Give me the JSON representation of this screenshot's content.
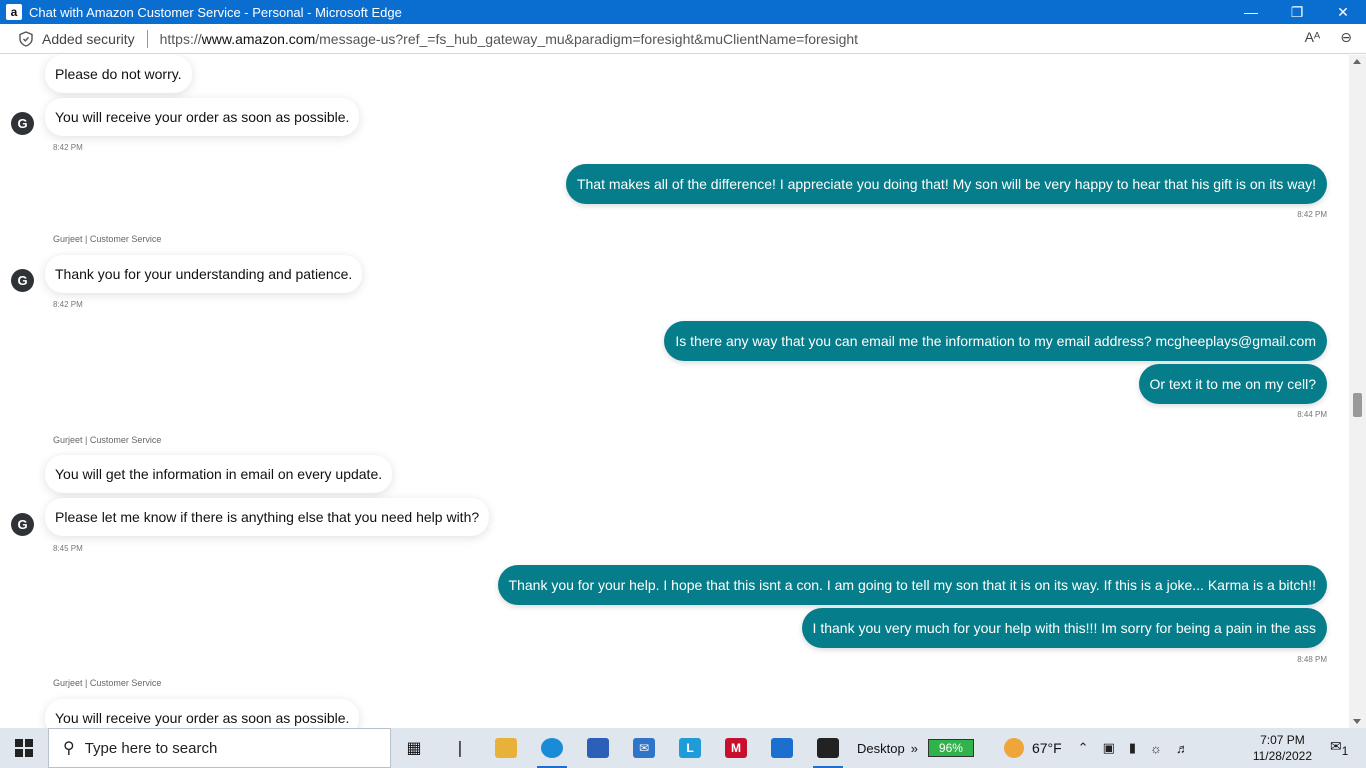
{
  "window": {
    "title": "Chat with Amazon Customer Service - Personal - Microsoft Edge",
    "app_icon": "a",
    "minimize": "—",
    "restore": "❐",
    "close": "✕"
  },
  "addressbar": {
    "security_label": "Added security",
    "url_prefix": "https://",
    "url_host": "www.amazon.com",
    "url_path": "/message-us?ref_=fs_hub_gateway_mu&paradigm=foresight&muClientName=foresight",
    "read_aloud_icon": "Aᴬ",
    "zoom_icon": "⊖"
  },
  "chat": {
    "agent_initial": "G",
    "messages": [
      {
        "text": "Please do not worry."
      },
      {
        "text": "You will receive your order as soon as possible.",
        "time": "8:42 PM"
      },
      {
        "text": "That makes all of the difference! I appreciate you doing that! My son will be very happy to hear that his gift is on its way!",
        "time": "8:42 PM"
      },
      {
        "sender": "Gurjeet | Customer Service",
        "text": "Thank you for your understanding and patience.",
        "time": "8:42 PM"
      },
      {
        "text": "Is there any way that you can email me the information to my email address? mcgheeplays@gmail.com"
      },
      {
        "text": "Or text it to me on my cell?",
        "time": "8:44 PM"
      },
      {
        "sender": "Gurjeet | Customer Service",
        "text": "You will get the information in email on every update."
      },
      {
        "text": "Please let me know if there is anything else that you need help with?",
        "time": "8:45 PM"
      },
      {
        "text": "Thank you for your help. I hope that this isnt a con. I am going to tell my son that it is on its way. If this is a joke... Karma is a bitch!!"
      },
      {
        "text": "I thank you very much for your help with this!!! Im sorry for being a pain in the ass",
        "time": "8:48 PM"
      },
      {
        "sender": "Gurjeet | Customer Service",
        "text": "You will receive your order as soon as possible."
      }
    ]
  },
  "taskbar": {
    "search_placeholder": "Type here to search",
    "desktop_label": "Desktop",
    "battery": "96%",
    "temperature": "67°F",
    "time": "7:07 PM",
    "date": "11/28/2022",
    "notification_count": "1",
    "chevron": "»",
    "accent_color": "#067d8a"
  }
}
